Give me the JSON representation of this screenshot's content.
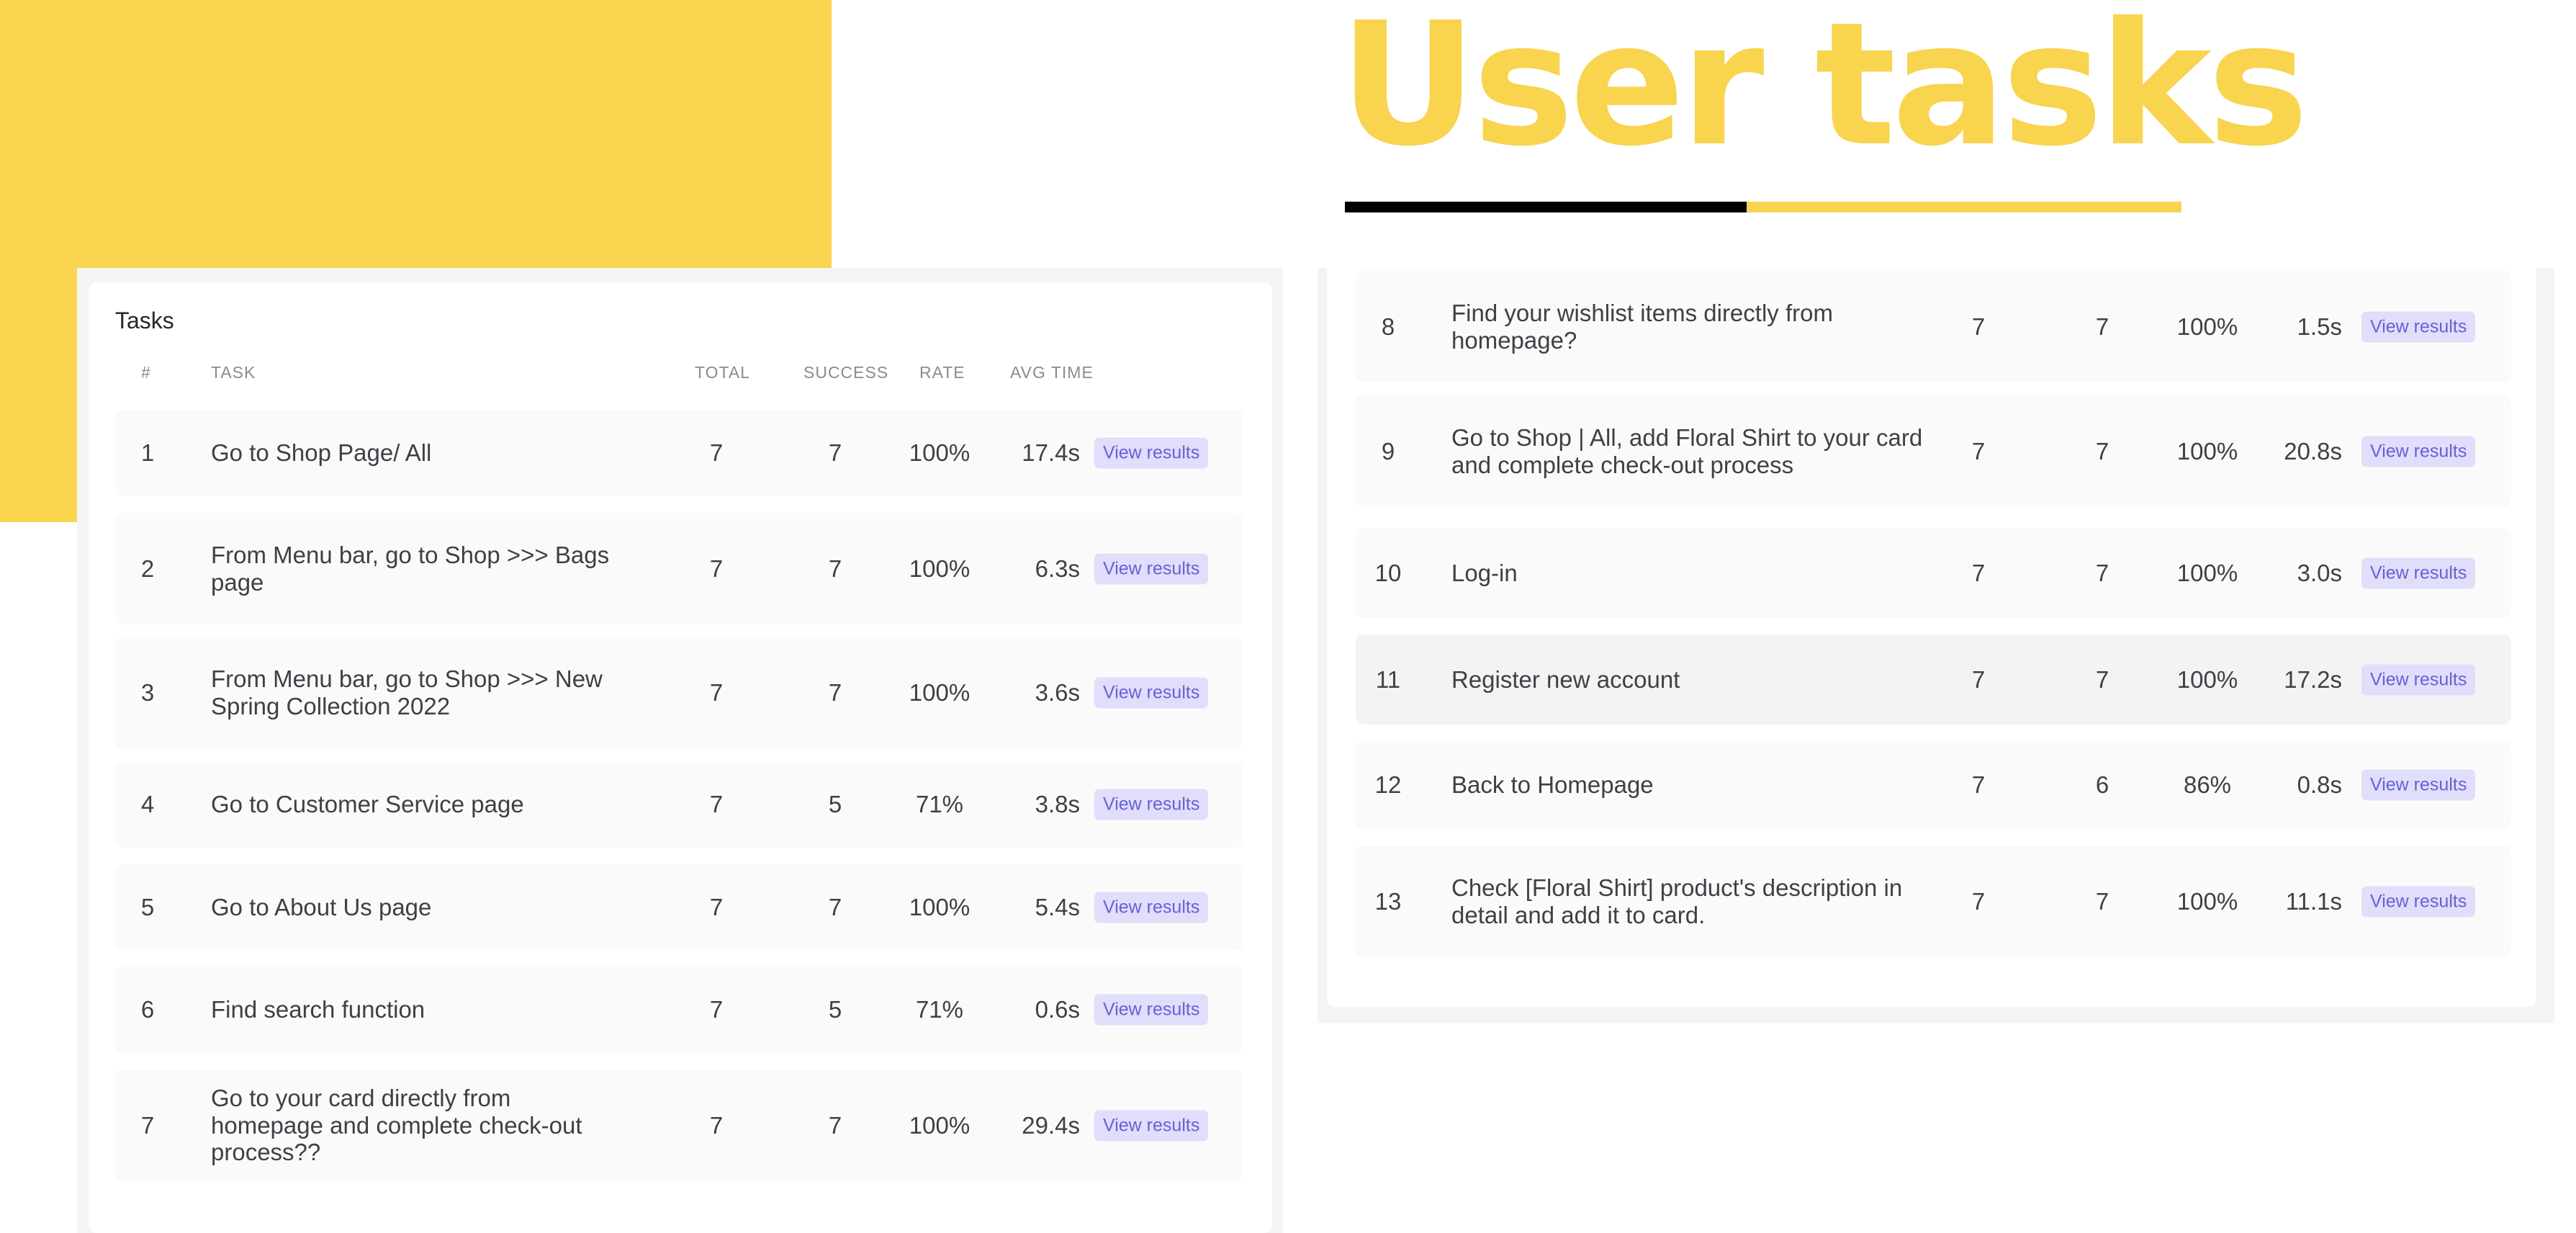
{
  "hero": {
    "title": "User tasks"
  },
  "colors": {
    "accent": "#f8d44f",
    "button_bg": "#e0defa",
    "button_text": "#6561d6"
  },
  "tasks_panel": {
    "title": "Tasks",
    "headers": {
      "num": "#",
      "task": "TASK",
      "total": "TOTAL",
      "success": "SUCCESS",
      "rate": "RATE",
      "avg_time": "AVG TIME"
    },
    "rows": [
      {
        "num": "1",
        "task": "Go to Shop Page/ All",
        "total": "7",
        "success": "7",
        "rate": "100%",
        "avg_time": "17.4s",
        "action": "View results"
      },
      {
        "num": "2",
        "task": "From Menu bar, go to Shop >>> Bags page",
        "total": "7",
        "success": "7",
        "rate": "100%",
        "avg_time": "6.3s",
        "action": "View results"
      },
      {
        "num": "3",
        "task": "From Menu bar, go to Shop >>> New Spring Collection 2022",
        "total": "7",
        "success": "7",
        "rate": "100%",
        "avg_time": "3.6s",
        "action": "View results"
      },
      {
        "num": "4",
        "task": "Go to Customer Service page",
        "total": "7",
        "success": "5",
        "rate": "71%",
        "avg_time": "3.8s",
        "action": "View results"
      },
      {
        "num": "5",
        "task": "Go to About Us page",
        "total": "7",
        "success": "7",
        "rate": "100%",
        "avg_time": "5.4s",
        "action": "View results"
      },
      {
        "num": "6",
        "task": "Find search function",
        "total": "7",
        "success": "5",
        "rate": "71%",
        "avg_time": "0.6s",
        "action": "View results"
      },
      {
        "num": "7",
        "task": "Go to your card directly from homepage and complete check-out process??",
        "total": "7",
        "success": "7",
        "rate": "100%",
        "avg_time": "29.4s",
        "action": "View results"
      }
    ]
  },
  "tasks_panel_continued": {
    "rows": [
      {
        "num": "8",
        "task": "Find your wishlist items directly from homepage?",
        "total": "7",
        "success": "7",
        "rate": "100%",
        "avg_time": "1.5s",
        "action": "View results"
      },
      {
        "num": "9",
        "task": "Go to Shop | All, add Floral Shirt to your card and complete check-out process",
        "total": "7",
        "success": "7",
        "rate": "100%",
        "avg_time": "20.8s",
        "action": "View results"
      },
      {
        "num": "10",
        "task": "Log-in",
        "total": "7",
        "success": "7",
        "rate": "100%",
        "avg_time": "3.0s",
        "action": "View results"
      },
      {
        "num": "11",
        "task": "Register new account",
        "total": "7",
        "success": "7",
        "rate": "100%",
        "avg_time": "17.2s",
        "action": "View results"
      },
      {
        "num": "12",
        "task": "Back to Homepage",
        "total": "7",
        "success": "6",
        "rate": "86%",
        "avg_time": "0.8s",
        "action": "View results"
      },
      {
        "num": "13",
        "task": "Check [Floral Shirt] product's description in detail and add it to card.",
        "total": "7",
        "success": "7",
        "rate": "100%",
        "avg_time": "11.1s",
        "action": "View results"
      }
    ]
  }
}
